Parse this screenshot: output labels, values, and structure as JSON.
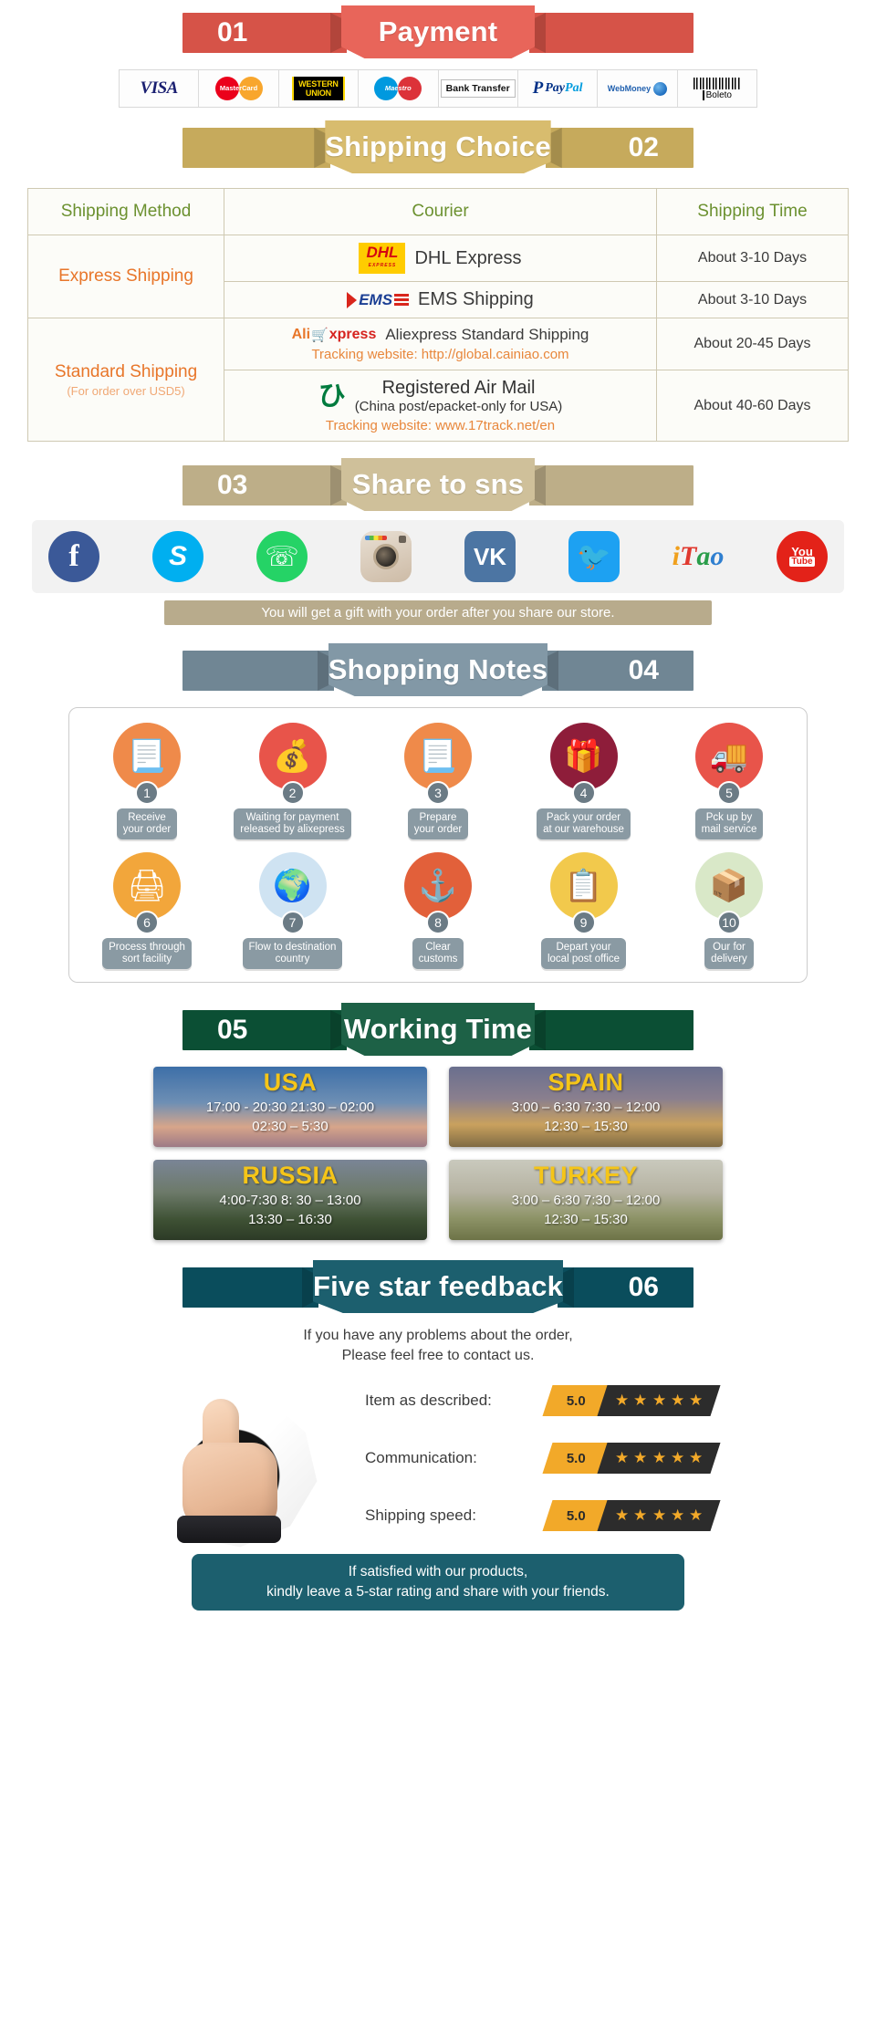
{
  "sections": {
    "payment": {
      "number": "01",
      "title": "Payment",
      "color": "#e8655a",
      "methods": [
        {
          "name": "visa",
          "label": "VISA"
        },
        {
          "name": "mastercard",
          "label": "MasterCard"
        },
        {
          "name": "western-union",
          "label": "WESTERN UNION"
        },
        {
          "name": "maestro",
          "label": "Maestro"
        },
        {
          "name": "bank-transfer",
          "label": "Bank Transfer"
        },
        {
          "name": "paypal",
          "label": "PayPal"
        },
        {
          "name": "webmoney",
          "label": "WebMoney"
        },
        {
          "name": "boleto",
          "label": "Boleto"
        }
      ]
    },
    "shipping": {
      "number": "02",
      "title": "Shipping Choice",
      "color": "#d8bc6e",
      "headers": [
        "Shipping Method",
        "Courier",
        "Shipping Time"
      ],
      "rows": [
        {
          "method": "Express Shipping",
          "method_sub": "",
          "couriers": [
            {
              "logo": "dhl",
              "name": "DHL Express",
              "track": "",
              "sub": "",
              "time": "About 3-10 Days"
            },
            {
              "logo": "ems",
              "name": "EMS Shipping",
              "track": "",
              "sub": "",
              "time": "About 3-10 Days"
            }
          ]
        },
        {
          "method": "Standard Shipping",
          "method_sub": "(For order over USD5)",
          "couriers": [
            {
              "logo": "aliexpress",
              "name": "Aliexpress Standard Shipping",
              "track": "Tracking website: http://global.cainiao.com",
              "sub": "",
              "time": "About 20-45 Days"
            },
            {
              "logo": "china-post",
              "name": "Registered Air Mail",
              "sub": "(China post/epacket-only for USA)",
              "track": "Tracking website: www.17track.net/en",
              "time": "About 40-60 Days"
            }
          ]
        }
      ]
    },
    "share": {
      "number": "03",
      "title": "Share to sns",
      "color": "#cfc09a",
      "networks": [
        {
          "name": "facebook-icon",
          "label": "f"
        },
        {
          "name": "skype-icon",
          "label": "S"
        },
        {
          "name": "whatsapp-icon",
          "label": "✆"
        },
        {
          "name": "instagram-icon",
          "label": ""
        },
        {
          "name": "vk-icon",
          "label": "VK"
        },
        {
          "name": "twitter-icon",
          "label": "ὂ6"
        },
        {
          "name": "itao-icon",
          "label": "iTao"
        },
        {
          "name": "youtube-icon",
          "label": "You Tube"
        }
      ],
      "gift_note": "You will get a gift with your order after you share our store."
    },
    "notes": {
      "number": "04",
      "title": "Shopping Notes",
      "color": "#8298a6",
      "steps": [
        {
          "num": "1",
          "label": "Receive\nyour order",
          "icon": "document-icon",
          "color": "#ef8a4a"
        },
        {
          "num": "2",
          "label": "Waiting for payment\nreleased by alixepress",
          "icon": "money-bag-icon",
          "color": "#e8544a"
        },
        {
          "num": "3",
          "label": "Prepare\nyour order",
          "icon": "document-icon",
          "color": "#ef8a4a"
        },
        {
          "num": "4",
          "label": "Pack your order\nat our warehouse",
          "icon": "gift-icon",
          "color": "#8e1d3a"
        },
        {
          "num": "5",
          "label": "Pck up by\nmail service",
          "icon": "mail-truck-icon",
          "color": "#e8544a"
        },
        {
          "num": "6",
          "label": "Process through\nsort facility",
          "icon": "scanner-icon",
          "color": "#f2a63b"
        },
        {
          "num": "7",
          "label": "Flow to destination\ncountry",
          "icon": "globe-icon",
          "color": "#cfe3f2"
        },
        {
          "num": "8",
          "label": "Clear\ncustoms",
          "icon": "anchor-icon",
          "color": "#e2603a"
        },
        {
          "num": "9",
          "label": "Depart your\nlocal post office",
          "icon": "clipboard-icon",
          "color": "#f2c94c"
        },
        {
          "num": "10",
          "label": "Our for\ndelivery",
          "icon": "package-icon",
          "color": "#d9e8c8"
        }
      ]
    },
    "working_time": {
      "number": "05",
      "title": "Working Time",
      "color": "#1d6146",
      "cards": [
        {
          "country": "USA",
          "class": "wt-usa",
          "times": "17:00  -  20:30   21:30  –  02:00\n02:30  –  5:30"
        },
        {
          "country": "SPAIN",
          "class": "wt-spain",
          "times": "3:00  –  6:30   7:30  –  12:00\n12:30  –  15:30"
        },
        {
          "country": "RUSSIA",
          "class": "wt-russia",
          "times": "4:00-7:30   8: 30  –  13:00\n13:30  –  16:30"
        },
        {
          "country": "TURKEY",
          "class": "wt-turkey",
          "times": "3:00  –  6:30   7:30  –  12:00\n12:30  –  15:30"
        }
      ]
    },
    "feedback": {
      "number": "06",
      "title": "Five star feedback",
      "color": "#1c5f6e",
      "intro": "If you have any problems about the order,\nPlease feel free to contact us.",
      "ratings": [
        {
          "label": "Item as described:",
          "score": "5.0",
          "stars": 5
        },
        {
          "label": "Communication:",
          "score": "5.0",
          "stars": 5
        },
        {
          "label": "Shipping speed:",
          "score": "5.0",
          "stars": 5
        }
      ],
      "final_note": "If satisfied with our products,\nkindly leave a 5-star rating and share with your friends."
    }
  }
}
